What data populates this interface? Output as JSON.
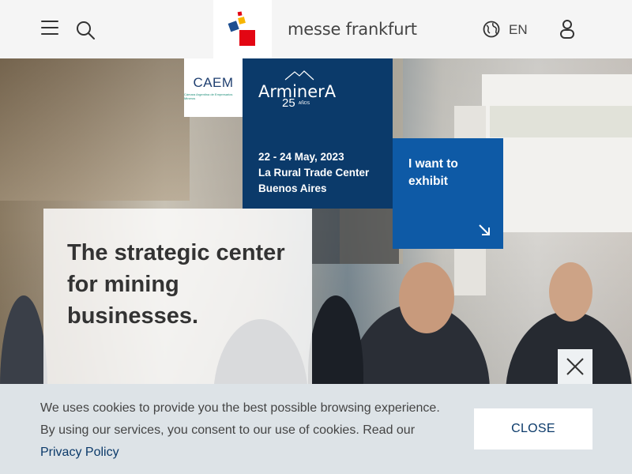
{
  "header": {
    "brand_name": "messe frankfurt",
    "language": "EN",
    "logo_colors": [
      "#e30613",
      "#1d4f91",
      "#f7b500"
    ]
  },
  "hero": {
    "partner_logo": {
      "name": "CAEM",
      "tagline": "Cámara Argentina de Empresarios Mineros"
    },
    "event": {
      "name": "ArminerA",
      "anniversary": "25",
      "anniversary_label": "AÑOS",
      "dates": "22 - 24 May, 2023",
      "venue": "La Rural Trade Center",
      "city": "Buenos Aires"
    },
    "cta": {
      "label": "I want to exhibit",
      "icon": "arrow-down-right-icon"
    },
    "tagline": "The strategic center for mining businesses."
  },
  "cookie_banner": {
    "text_line1": "We uses cookies to provide you the best possible browsing experience.",
    "text_line2": "By using our services, you consent to our use of cookies. Read our",
    "link_label": "Privacy Policy",
    "close_label": "CLOSE"
  },
  "colors": {
    "header_bg": "#f5f5f5",
    "event_navy": "#0b3a6a",
    "cta_blue": "#0e5aa6",
    "cookie_bg": "#dde3e7"
  }
}
